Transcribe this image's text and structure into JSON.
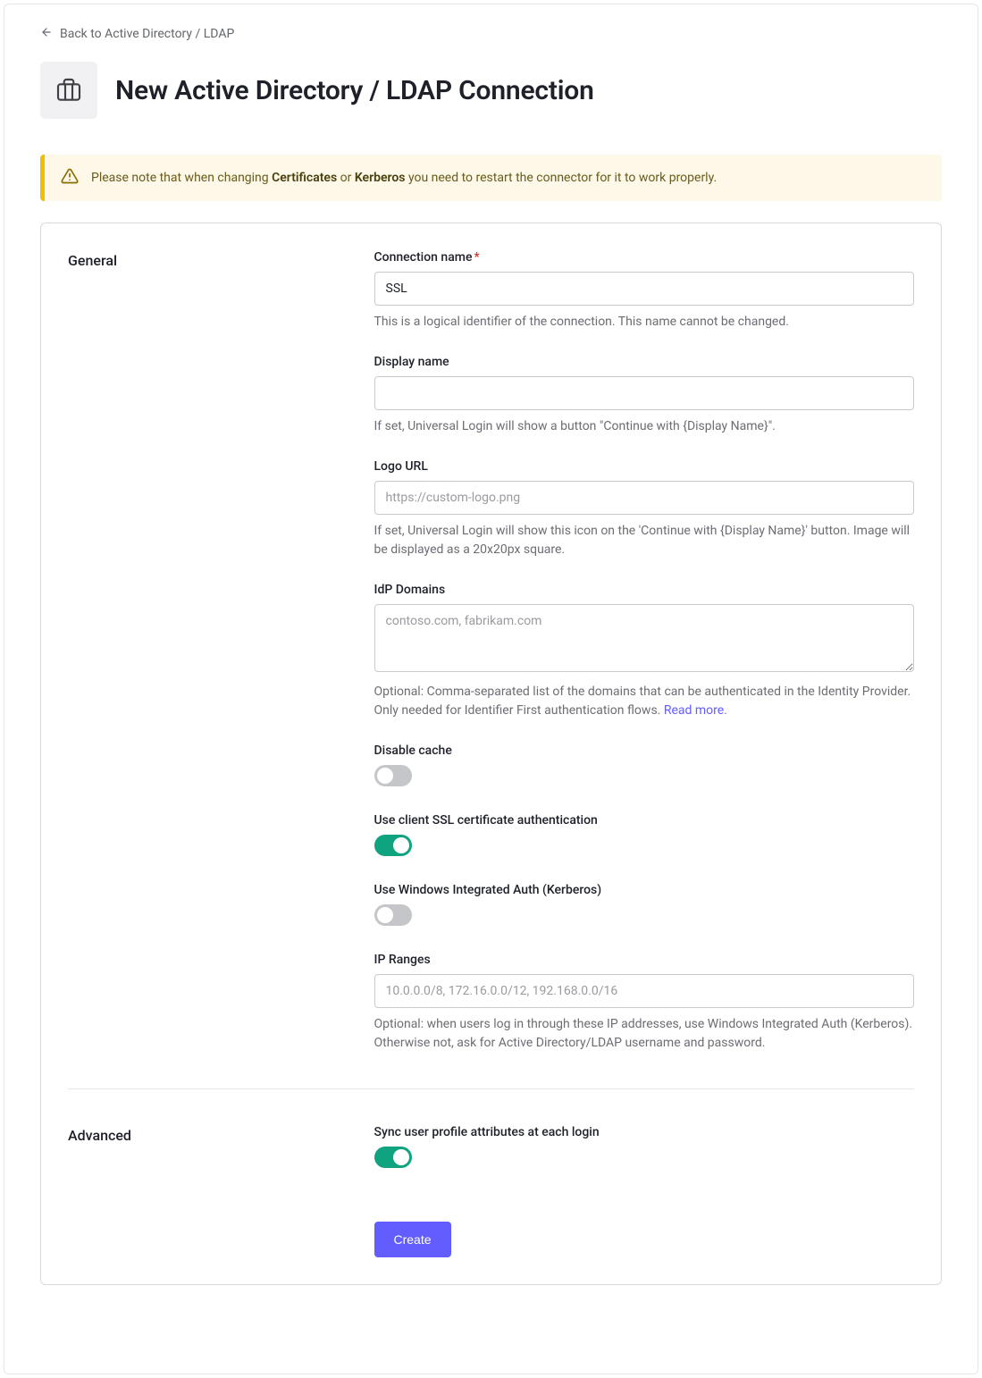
{
  "nav": {
    "back": "Back to Active Directory / LDAP"
  },
  "page": {
    "title": "New Active Directory / LDAP Connection"
  },
  "notice": {
    "pre": "Please note that when changing ",
    "b1": "Certificates",
    "mid": " or ",
    "b2": "Kerberos",
    "post": " you need to restart the connector for it to work properly."
  },
  "sections": {
    "general": {
      "title": "General",
      "connection_name": {
        "label": "Connection name",
        "value": "SSL",
        "hint": "This is a logical identifier of the connection. This name cannot be changed."
      },
      "display_name": {
        "label": "Display name",
        "value": "",
        "hint": "If set, Universal Login will show a button \"Continue with {Display Name}\"."
      },
      "logo_url": {
        "label": "Logo URL",
        "placeholder": "https://custom-logo.png",
        "value": "",
        "hint": "If set, Universal Login will show this icon on the 'Continue with {Display Name}' button. Image will be displayed as a 20x20px square."
      },
      "idp_domains": {
        "label": "IdP Domains",
        "placeholder": "contoso.com, fabrikam.com",
        "value": "",
        "hint_pre": "Optional: Comma-separated list of the domains that can be authenticated in the Identity Provider. Only needed for Identifier First authentication flows. ",
        "hint_link": "Read more."
      },
      "disable_cache": {
        "label": "Disable cache",
        "on": false
      },
      "use_client_ssl": {
        "label": "Use client SSL certificate authentication",
        "on": true
      },
      "use_kerberos": {
        "label": "Use Windows Integrated Auth (Kerberos)",
        "on": false
      },
      "ip_ranges": {
        "label": "IP Ranges",
        "placeholder": "10.0.0.0/8, 172.16.0.0/12, 192.168.0.0/16",
        "value": "",
        "hint": "Optional: when users log in through these IP addresses, use Windows Integrated Auth (Kerberos). Otherwise not, ask for Active Directory/LDAP username and password."
      }
    },
    "advanced": {
      "title": "Advanced",
      "sync_profile": {
        "label": "Sync user profile attributes at each login",
        "on": true
      }
    }
  },
  "actions": {
    "create": "Create"
  }
}
